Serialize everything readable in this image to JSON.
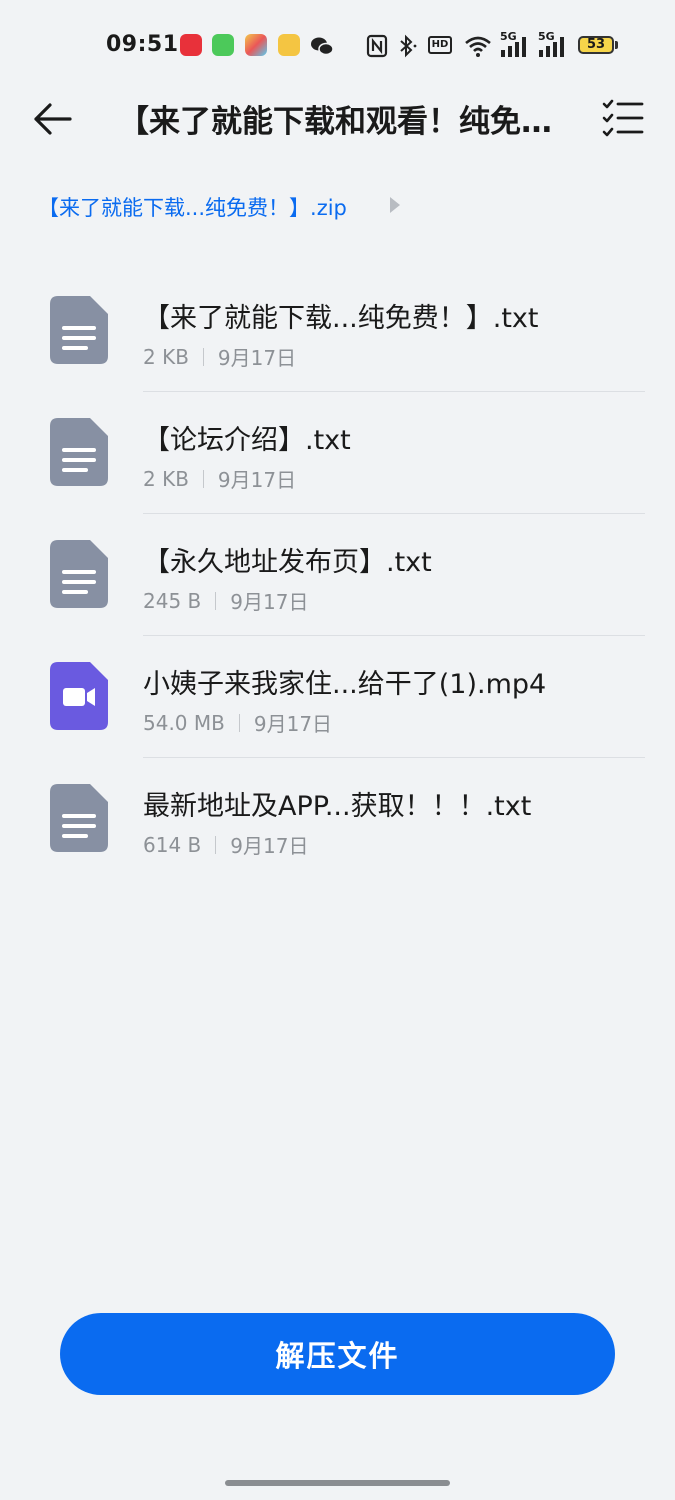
{
  "status_bar": {
    "time": "09:51",
    "battery_level": "53",
    "network_label_1": "5G",
    "network_label_2": "5G",
    "hd_label": "HD",
    "colors": {
      "battery_fill": "#f6d54a"
    }
  },
  "toolbar": {
    "title": "【来了就能下载和观看！纯免…",
    "back_icon": "back-arrow-icon",
    "menu_icon": "checklist-menu-icon"
  },
  "breadcrumb": {
    "current": "【来了就能下载...纯免费！】.zip"
  },
  "files": [
    {
      "name": "【来了就能下载...纯免费！】.txt",
      "size": "2 KB",
      "date": "9月17日",
      "type": "text",
      "icon": "text-document-icon"
    },
    {
      "name": "【论坛介绍】.txt",
      "size": "2 KB",
      "date": "9月17日",
      "type": "text",
      "icon": "text-document-icon"
    },
    {
      "name": "【永久地址发布页】.txt",
      "size": "245 B",
      "date": "9月17日",
      "type": "text",
      "icon": "text-document-icon"
    },
    {
      "name": "小姨子来我家住...给干了(1).mp4",
      "size": "54.0 MB",
      "date": "9月17日",
      "type": "video",
      "icon": "video-file-icon"
    },
    {
      "name": "最新地址及APP...获取！！！.txt",
      "size": "614 B",
      "date": "9月17日",
      "type": "text",
      "icon": "text-document-icon"
    }
  ],
  "actions": {
    "extract_label": "解压文件"
  },
  "colors": {
    "accent": "#0a6bf0",
    "text_file_icon": "#8790a3",
    "video_file_icon": "#6a5ae0",
    "background": "#f1f3f5"
  }
}
